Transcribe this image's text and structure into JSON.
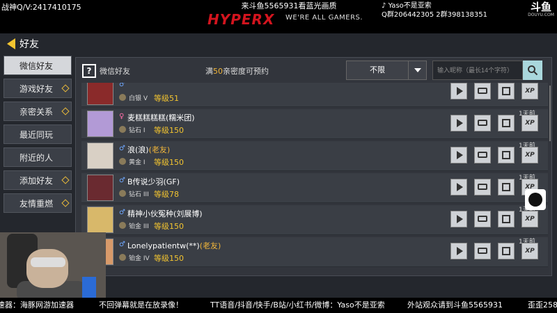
{
  "overlay": {
    "top_left": "战神Q/V:2417410175",
    "top_center": "来斗鱼5565931看蓝光画质",
    "brand": "HYPERX",
    "brand_slogan": "WE'RE ALL GAMERS.",
    "top_right_line1": "Yaso不是亚索",
    "top_right_line2": "Q群206442305   2群398138351",
    "logo_cn": "斗鱼",
    "logo_en": "DOUYU.COM"
  },
  "header": {
    "back_title": "好友"
  },
  "sidebar": {
    "items": [
      {
        "label": "微信好友",
        "active": true,
        "badge": false
      },
      {
        "label": "游戏好友",
        "active": false,
        "badge": true
      },
      {
        "label": "亲密关系",
        "active": false,
        "badge": true
      },
      {
        "label": "最近同玩",
        "active": false,
        "badge": false
      },
      {
        "label": "附近的人",
        "active": false,
        "badge": false
      },
      {
        "label": "添加好友",
        "active": false,
        "badge": true
      },
      {
        "label": "友情重燃",
        "active": false,
        "badge": true
      }
    ]
  },
  "panel": {
    "icon_glyph": "?",
    "title": "微信好友",
    "pref_prefix": "满",
    "pref_num": "50",
    "pref_suffix": "亲密度可预约",
    "filter_value": "不限",
    "search_placeholder": "输入昵称（最长14个字符）"
  },
  "rows": [
    {
      "gender": "♂",
      "gender_type": "male",
      "name": "",
      "tag": "",
      "rank": "白银 V",
      "level": "等级51",
      "ago": "",
      "xp": "XP"
    },
    {
      "gender": "♀",
      "gender_type": "female",
      "name": "麦糕糕糕糕(糯米团)",
      "tag": "",
      "rank": "钻石 I",
      "level": "等级150",
      "ago": "1天前",
      "xp": "XP"
    },
    {
      "gender": "♂",
      "gender_type": "male",
      "name": "浪(浪)",
      "tag": "(老友)",
      "rank": "黄金 I",
      "level": "等级150",
      "ago": "1天前",
      "xp": "XP"
    },
    {
      "gender": "♂",
      "gender_type": "male",
      "name": "B传说少羽(GF)",
      "tag": "",
      "rank": "钻石 III",
      "level": "等级78",
      "ago": "1天前",
      "xp": "XP"
    },
    {
      "gender": "♂",
      "gender_type": "male",
      "name": "精神小伙冤种(刘展博)",
      "tag": "",
      "rank": "铂金 III",
      "level": "等级150",
      "ago": "1天前",
      "xp": "XP"
    },
    {
      "gender": "♂",
      "gender_type": "male",
      "name": "Lonelypatientw(**)",
      "tag": "(老友)",
      "rank": "铂金 IV",
      "level": "等级150",
      "ago": "1天前",
      "xp": "XP"
    }
  ],
  "ticker": [
    "速器：海豚网游加速器",
    "不回弹幕就是在放录像！",
    "TT语音/抖音/快手/B站/小红书/微博：Yaso不是亚索",
    "外站观众请到斗鱼5565931",
    "歪歪258"
  ]
}
